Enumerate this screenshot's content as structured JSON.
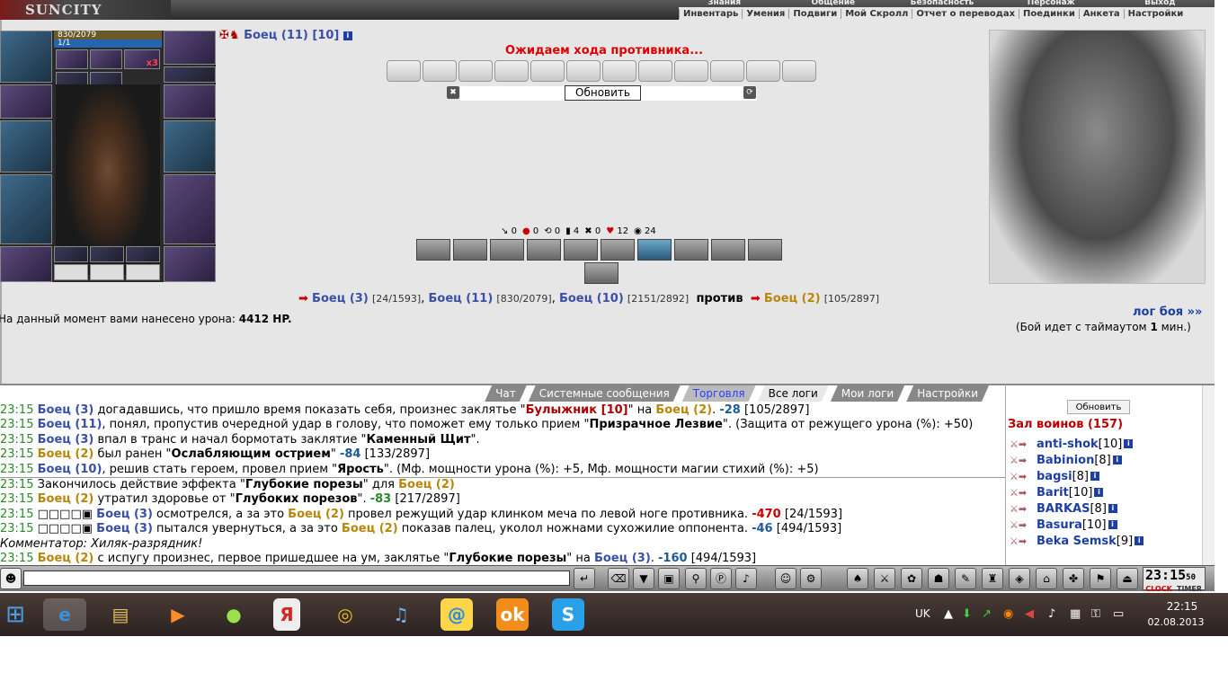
{
  "app": {
    "logo": "SUNCITY"
  },
  "top_menu": [
    "Знания",
    "Общение",
    "Безопасность",
    "Персонаж",
    "Выход"
  ],
  "sub_menu": [
    "Инвентарь",
    "Умения",
    "Подвиги",
    "Мой Скролл",
    "Отчет о переводах",
    "Поединки",
    "Анкета",
    "Настройки"
  ],
  "character": {
    "hp": "830/2079",
    "mp": "1/1",
    "badge": "x3",
    "title": "Боец (11) [10]"
  },
  "battle": {
    "waiting": "Ожидаем хода противника...",
    "refresh": "Обновить",
    "stats": [
      {
        "icon": "sword-icon",
        "value": "0"
      },
      {
        "icon": "drop-icon",
        "value": "0"
      },
      {
        "icon": "link-icon",
        "value": "0"
      },
      {
        "icon": "shield-icon",
        "value": "4"
      },
      {
        "icon": "cross-icon",
        "value": "0"
      },
      {
        "icon": "heart-icon",
        "value": "12"
      },
      {
        "icon": "armor-icon",
        "value": "24"
      }
    ],
    "line": {
      "f1": "Боец (3)",
      "f1s": "[24/1593]",
      "f2": "Боец (11)",
      "f2s": "[830/2079]",
      "f3": "Боец (10)",
      "f3s": "[2151/2892]",
      "vs": "против",
      "e1": "Боец (2)",
      "e1s": "[105/2897]"
    },
    "damage_label": "На данный момент вами нанесено урона:",
    "damage_value": "4412 HP.",
    "log_link": "лог боя »»",
    "timeout_prefix": "(Бой идет с таймаутом",
    "timeout_value": "1",
    "timeout_suffix": "мин.)"
  },
  "chat_tabs": [
    "Чат",
    "Системные сообщения",
    "Торговля",
    "Все логи",
    "Мои логи",
    "Настройки"
  ],
  "log": [
    {
      "time": "23:15",
      "pre": "",
      "a": "Боец (3)",
      "ac": "b",
      "t1": " догадавшись, что пришло время показать себя, произнес заклятье \"",
      "k": "Булыжник [10]",
      "kc": "red",
      "t2": "\" на ",
      "b": "Боец (2)",
      "bc": "r",
      "t3": ". ",
      "v": "-28",
      "vc": "q",
      "t4": " [105/2897]"
    },
    {
      "time": "23:15",
      "pre": "",
      "a": "Боец (11)",
      "ac": "b",
      "t1": ", понял, пропустив очередной удар в голову, что поможет ему только прием \"",
      "k": "Призрачное Лезвие",
      "kc": "blk",
      "t2": "\". (Защита от режущего урона (%): +50)",
      "b": "",
      "bc": "",
      "t3": "",
      "v": "",
      "vc": "",
      "t4": ""
    },
    {
      "time": "23:15",
      "pre": "",
      "a": "Боец (3)",
      "ac": "b",
      "t1": " впал в транс и начал бормотать заклятие \"",
      "k": "Каменный Щит",
      "kc": "blk",
      "t2": "\".",
      "b": "",
      "bc": "",
      "t3": "",
      "v": "",
      "vc": "",
      "t4": ""
    },
    {
      "time": "23:15",
      "pre": "",
      "a": "Боец (2)",
      "ac": "r",
      "t1": " был ранен \"",
      "k": "Ослабляющим острием",
      "kc": "blk",
      "t2": "\" ",
      "b": "",
      "bc": "",
      "t3": "",
      "v": "-84",
      "vc": "q",
      "t4": " [133/2897]"
    },
    {
      "time": "23:15",
      "pre": "",
      "a": "Боец (10)",
      "ac": "b",
      "t1": ", решив стать героем, провел прием \"",
      "k": "Ярость",
      "kc": "blk",
      "t2": "\". (Мф. мощности урона (%): +5, Мф. мощности магии стихий (%): +5)",
      "b": "",
      "bc": "",
      "t3": "",
      "v": "",
      "vc": "",
      "t4": ""
    },
    {
      "time": "23:15",
      "pre": "Закончилось действие эффекта \"",
      "a": "",
      "ac": "",
      "t1": "",
      "k": "Глубокие порезы",
      "kc": "blk",
      "t2": "\" для ",
      "b": "Боец (2)",
      "bc": "r",
      "t3": "",
      "v": "",
      "vc": "",
      "t4": ""
    },
    {
      "time": "23:15",
      "pre": "",
      "a": "Боец (2)",
      "ac": "r",
      "t1": " утратил здоровье от \"",
      "k": "Глубоких порезов",
      "kc": "blk",
      "t2": "\". ",
      "b": "",
      "bc": "",
      "t3": "",
      "v": "-83",
      "vc": "h",
      "t4": " [217/2897]"
    },
    {
      "time": "23:15",
      "pre": "□□□□▣ ",
      "a": "Боец (3)",
      "ac": "b",
      "t1": " осмотрелся, а за это ",
      "k": "Боец (2)",
      "kc": "r",
      "t2": " провел режущий удар клинком меча по левой ноге противника. ",
      "b": "",
      "bc": "",
      "t3": "",
      "v": "-470",
      "vc": "v",
      "t4": " [24/1593]"
    },
    {
      "time": "23:15",
      "pre": "□□□□▣ ",
      "a": "Боец (3)",
      "ac": "b",
      "t1": " пытался увернуться, а за это ",
      "k": "Боец (2)",
      "kc": "r",
      "t2": " показав палец, уколол ножнами сухожилие оппонента. ",
      "b": "",
      "bc": "",
      "t3": "",
      "v": "-46",
      "vc": "q",
      "t4": " [494/1593]"
    },
    {
      "time": "",
      "pre": "Комментатор: Хиляк-разрядник!",
      "a": "",
      "ac": "",
      "t1": "",
      "k": "",
      "kc": "",
      "t2": "",
      "b": "",
      "bc": "",
      "t3": "",
      "v": "",
      "vc": "",
      "t4": ""
    },
    {
      "time": "23:15",
      "pre": "",
      "a": "Боец (2)",
      "ac": "r",
      "t1": " с испугу произнес, первое пришедшее на ум, заклятье \"",
      "k": "Глубокие порезы",
      "kc": "blk",
      "t2": "\" на ",
      "b": "Боец (3)",
      "bc": "b",
      "t3": ". ",
      "v": "-160",
      "vc": "q",
      "t4": " [494/1593]"
    }
  ],
  "right": {
    "refresh": "Обновить",
    "hall": "Зал воинов (157)",
    "players": [
      {
        "name": "anti-shok",
        "lvl": "[10]"
      },
      {
        "name": "Babinion",
        "lvl": "[8]"
      },
      {
        "name": "bagsi",
        "lvl": "[8]"
      },
      {
        "name": "Barit",
        "lvl": "[10]"
      },
      {
        "name": "BARKAS",
        "lvl": "[8]"
      },
      {
        "name": "Basura",
        "lvl": "[10]"
      },
      {
        "name": "Beka Semsk",
        "lvl": "[9]"
      }
    ]
  },
  "clock": {
    "time": "23:15",
    "sec": "50",
    "l1": "CLOCK",
    "l2": "TIMER"
  },
  "taskbar": {
    "lang": "UK",
    "time": "22:15",
    "date": "02.08.2013"
  },
  "colors": {
    "accent": "#3a4fa8",
    "enemy": "#b8860b",
    "alert": "#dd0000"
  }
}
